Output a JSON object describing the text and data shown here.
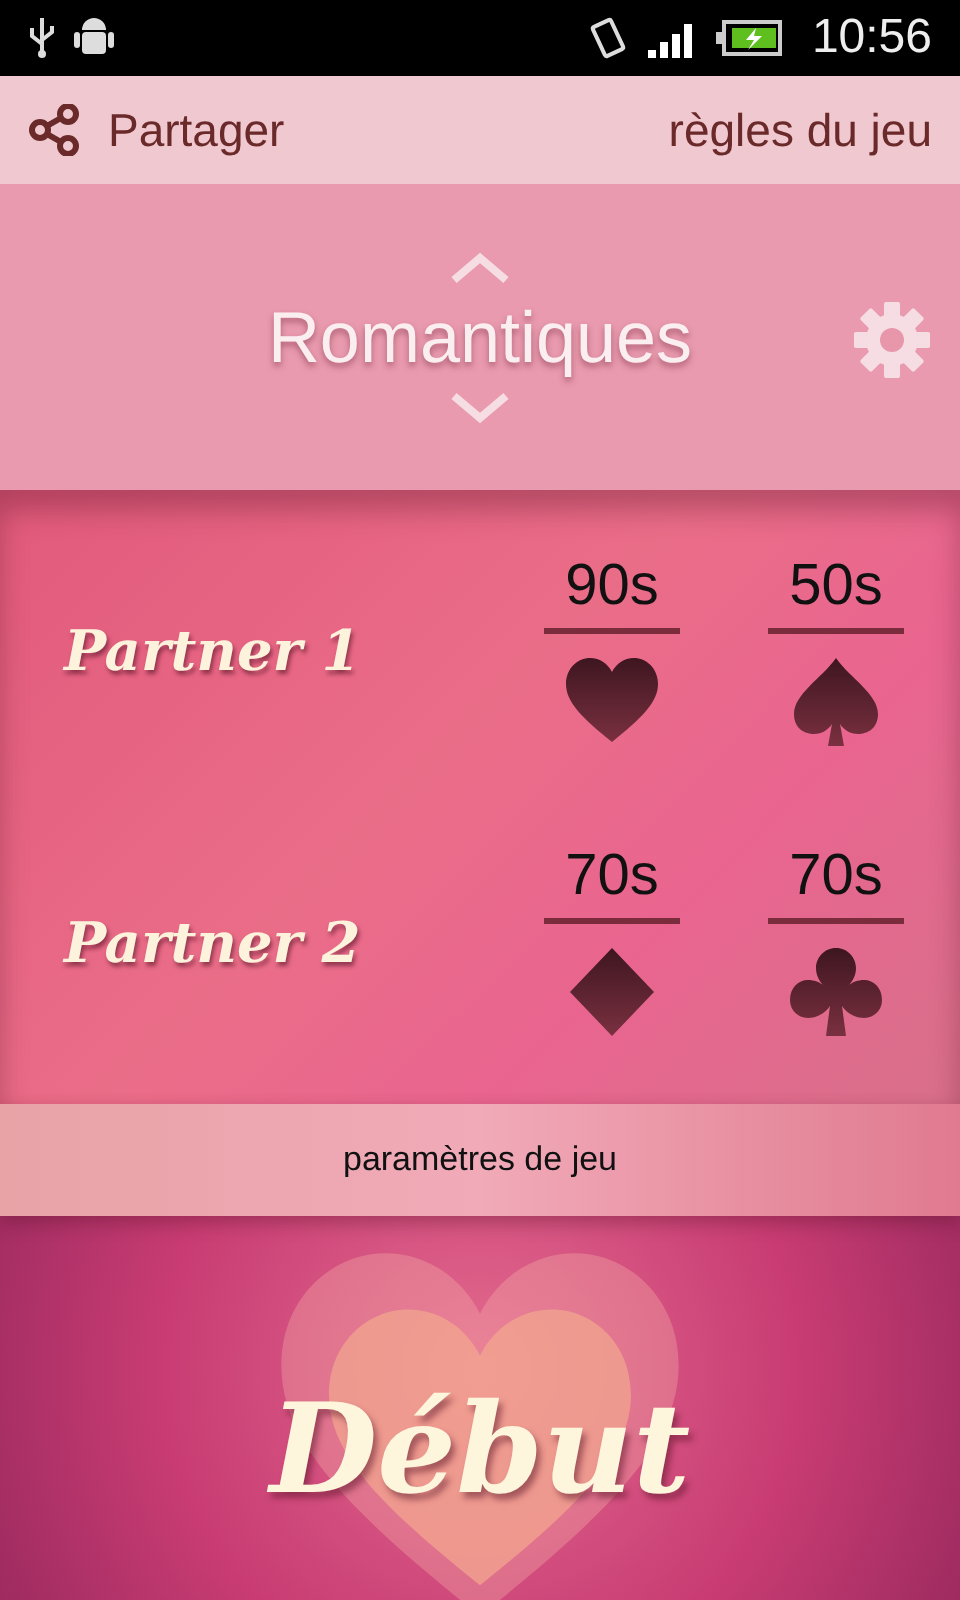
{
  "status_bar": {
    "time": "10:56"
  },
  "action_bar": {
    "share": "Partager",
    "rules": "règles du jeu"
  },
  "mode_selector": {
    "mode": "Romantiques"
  },
  "partners": [
    {
      "name": "Partner 1",
      "timers": [
        {
          "time": "90s",
          "kind": "heart"
        },
        {
          "time": "50s",
          "kind": "spade"
        }
      ]
    },
    {
      "name": "Partner 2",
      "timers": [
        {
          "time": "70s",
          "kind": "diamond"
        },
        {
          "time": "70s",
          "kind": "club"
        }
      ]
    }
  ],
  "settings_button": "paramètres de jeu",
  "start_button": "Début"
}
